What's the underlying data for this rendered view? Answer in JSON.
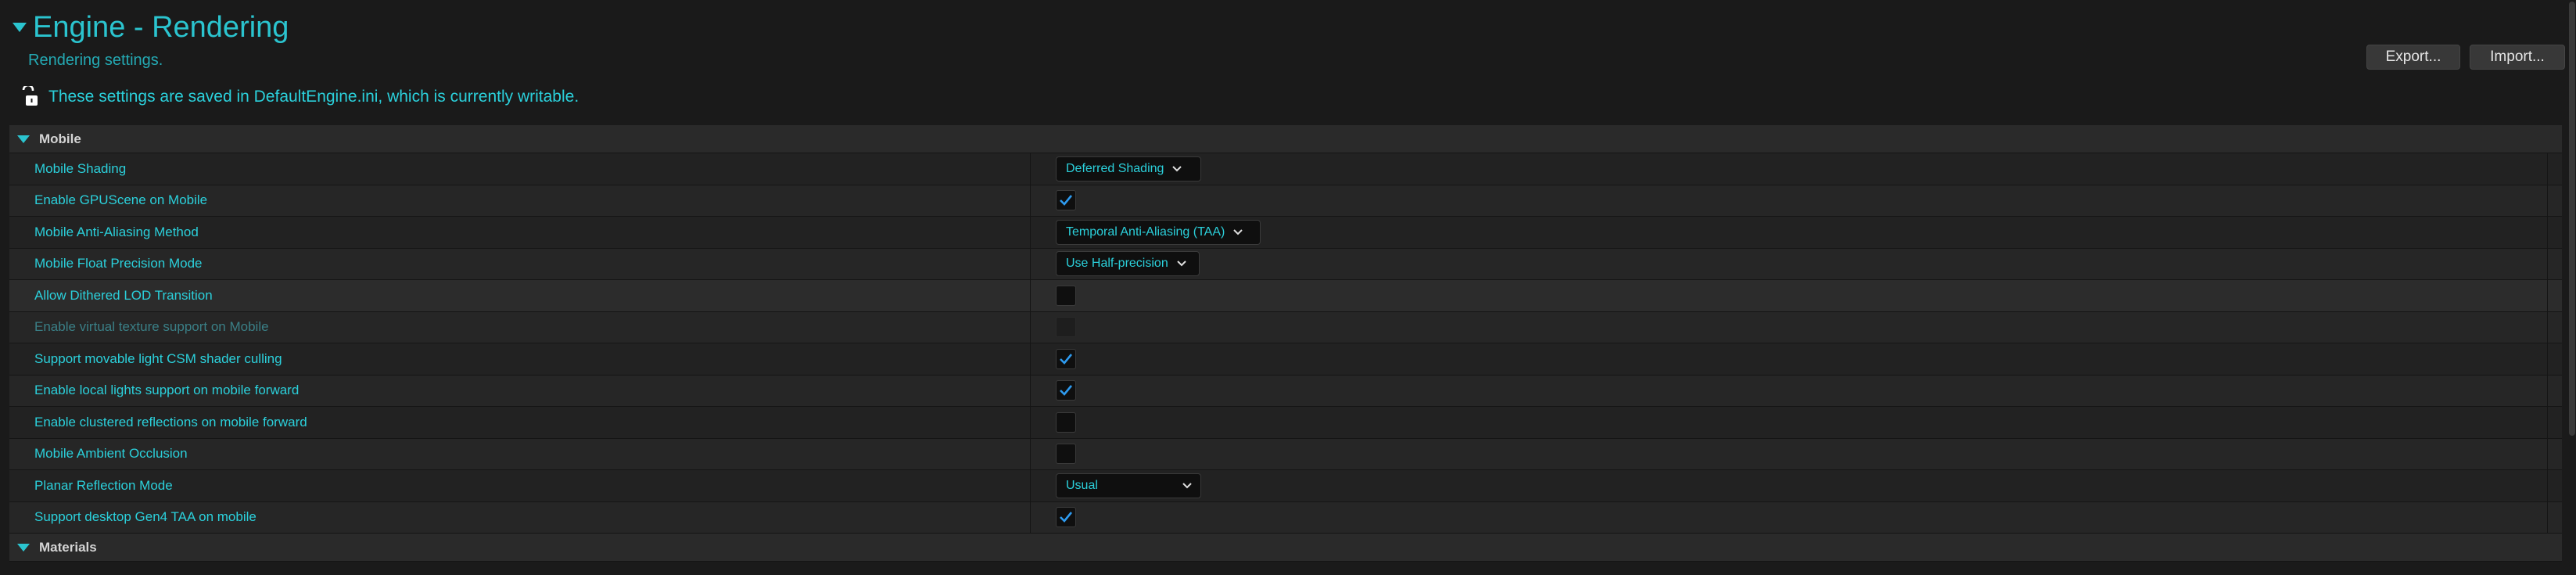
{
  "header": {
    "title": "Engine - Rendering",
    "subtitle": "Rendering settings.",
    "writable_notice": "These settings are saved in DefaultEngine.ini, which is currently writable.",
    "export_label": "Export...",
    "import_label": "Import..."
  },
  "categories": {
    "mobile": "Mobile",
    "materials": "Materials"
  },
  "rows": [
    {
      "label": "Mobile Shading",
      "type": "combo",
      "value": "Deferred Shading"
    },
    {
      "label": "Enable GPUScene on Mobile",
      "type": "checkbox",
      "checked": true
    },
    {
      "label": "Mobile Anti-Aliasing Method",
      "type": "combo",
      "value": "Temporal Anti-Aliasing (TAA)"
    },
    {
      "label": "Mobile Float Precision Mode",
      "type": "combo",
      "value": "Use Half-precision"
    },
    {
      "label": "Allow Dithered LOD Transition",
      "type": "checkbox",
      "checked": false
    },
    {
      "label": "Enable virtual texture support on Mobile",
      "type": "checkbox",
      "checked": false,
      "disabled": true
    },
    {
      "label": "Support movable light CSM shader culling",
      "type": "checkbox",
      "checked": true
    },
    {
      "label": "Enable local lights support on mobile forward",
      "type": "checkbox",
      "checked": true
    },
    {
      "label": "Enable clustered reflections on mobile forward",
      "type": "checkbox",
      "checked": false
    },
    {
      "label": "Mobile Ambient Occlusion",
      "type": "checkbox",
      "checked": false
    },
    {
      "label": "Planar Reflection Mode",
      "type": "combo",
      "value": "Usual"
    },
    {
      "label": "Support desktop Gen4 TAA on mobile",
      "type": "checkbox",
      "checked": true
    }
  ],
  "icons": {
    "lock": "unlocked-lock-icon",
    "chevron": "chevron-down-icon",
    "check": "checkmark-icon",
    "caret": "caret-down-icon"
  },
  "colors": {
    "accent": "#2bd0db",
    "check": "#2e9bf0",
    "background": "#1a1a1a"
  }
}
